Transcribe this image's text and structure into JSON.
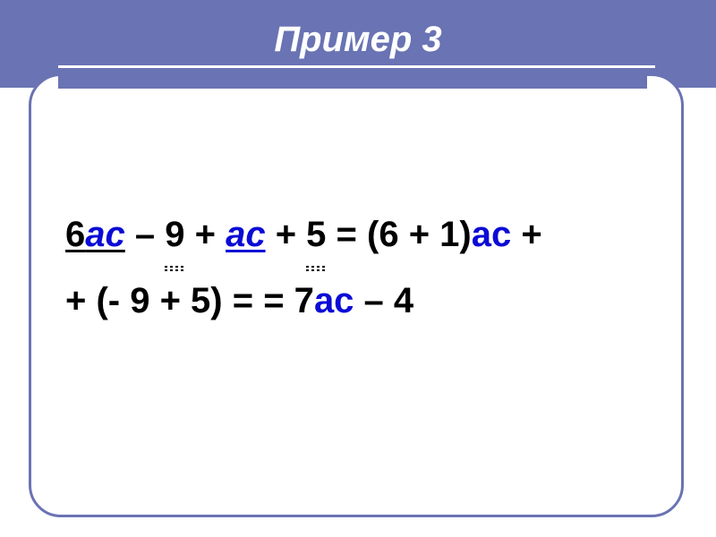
{
  "title": "Пример 3",
  "equation": {
    "line1": {
      "p1": "6",
      "ac1": "ас",
      "p2": " – ",
      "n9": "9",
      "p3": " + ",
      "ac2": "ас",
      "p4": " + ",
      "n5": "5",
      "p5": " = (6 + 1)",
      "ac3": "ас",
      "p6": " +"
    },
    "line2": {
      "p1": "+ (- 9 + 5) = = 7",
      "ac": "ас",
      "p2": " – 4"
    }
  }
}
